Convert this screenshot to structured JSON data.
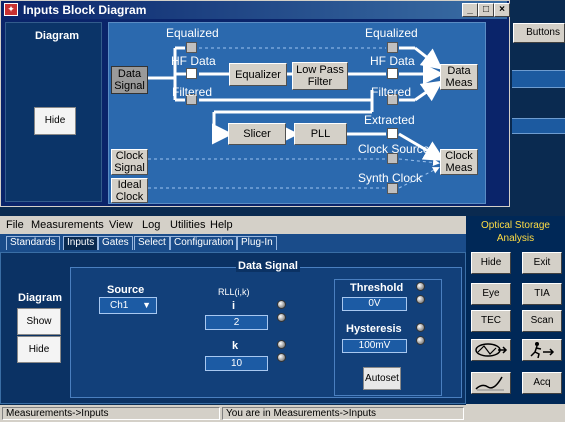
{
  "diagram_window": {
    "title": "Inputs Block Diagram",
    "min_glyph": "_",
    "max_glyph": "□",
    "close_glyph": "×",
    "side_title": "Diagram",
    "hide_label": "Hide",
    "blocks": {
      "data_signal": "Data Signal",
      "equalizer": "Equalizer",
      "low_pass_filter": "Low Pass Filter",
      "data_meas": "Data Meas",
      "slicer": "Slicer",
      "pll": "PLL",
      "clock_signal": "Clock Signal",
      "ideal_clock": "Ideal Clock",
      "clock_meas": "Clock Meas"
    },
    "labels": {
      "equalized_left": "Equalized",
      "hf_data_left": "HF Data",
      "filtered_left": "Filtered",
      "equalized_right": "Equalized",
      "hf_data_right": "HF Data",
      "filtered_right": "Filtered",
      "extracted": "Extracted",
      "clock_source": "Clock Source",
      "synth_clock": "Synth Clock"
    }
  },
  "right_window": {
    "buttons_label": "Buttons"
  },
  "menu": {
    "file": "File",
    "measurements": "Measurements",
    "view": "View",
    "log": "Log",
    "utilities": "Utilities",
    "help": "Help"
  },
  "tabs": [
    "Standards",
    "Inputs",
    "Gates",
    "Select",
    "Configuration",
    "Plug-In"
  ],
  "left_panel": {
    "title": "Diagram",
    "show_label": "Show",
    "hide_label": "Hide"
  },
  "data_signal_panel": {
    "title": "Data Signal",
    "source_label": "Source",
    "source_value": "Ch1",
    "rll_label": "RLL(i,k)",
    "i_label": "i",
    "i_value": "2",
    "k_label": "k",
    "k_value": "10",
    "threshold_label": "Threshold",
    "threshold_value": "0V",
    "hysteresis_label": "Hysteresis",
    "hysteresis_value": "100mV",
    "autoset_label": "Autoset"
  },
  "optical_storage": {
    "title": "Optical Storage Analysis",
    "buttons": [
      "Hide",
      "Exit",
      "Eye",
      "TIA",
      "TEC",
      "Scan",
      "Acq"
    ],
    "wave_icon": "waveform-icon",
    "runner_icon": "runner-arrow-icon",
    "curve_icon": "curve-icon"
  },
  "status": {
    "left": "Measurements->Inputs",
    "right": "You are in Measurements->Inputs"
  },
  "colors": {
    "title_bar": "#0a246a",
    "canvas": "#2b69ae",
    "panel_bg": "#0b3264",
    "accent_yellow": "#ffdd44"
  }
}
